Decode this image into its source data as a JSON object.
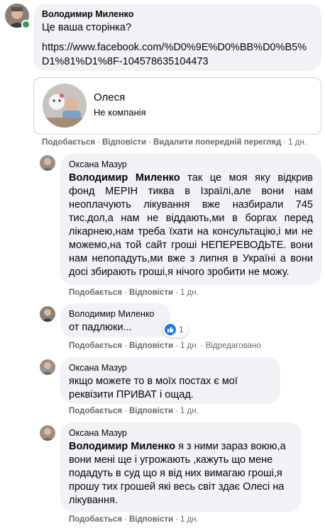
{
  "comment1": {
    "author": "Володимир Миленко",
    "text": "Це ваша сторінка?",
    "link": "https://www.facebook.com/%D0%9E%D0%BB%D0%B5%D1%81%D1%8F-104578635104473",
    "actions": {
      "like": "Подобається",
      "reply": "Відповісти",
      "remove": "Видалити попередній перегляд",
      "time": "1 дн."
    }
  },
  "link_preview": {
    "name": "Олеся",
    "subtitle": "Не компанія"
  },
  "comment2": {
    "author": "Оксана Мазур",
    "mention": "Володимир Миленко",
    "text": " так це моя яку відкрив фонд МЕРІН тиква в Ізраїлі,але вони нам неоплачують лікування вже назбирали 745 тис.дол,а нам не віддають,ми в боргах перед лікарнею,нам треба їхати на консультацію,і ми не можемо,на той сайт гроші НЕПЕРЕВОДЬТЕ. вони нам непопадуть,ми вже з липня в Україні а вони досі збирають гроші,я нічого зробити не можу.",
    "actions": {
      "like": "Подобається",
      "reply": "Відповісти",
      "time": "1 дн."
    }
  },
  "comment3": {
    "author": "Володимир Миленко",
    "text": "от падлюки...",
    "reaction_count": "1",
    "actions": {
      "like": "Подобається",
      "reply": "Відповісти",
      "time": "1 дн.",
      "edited": "Відредаговано"
    }
  },
  "comment4": {
    "author": "Оксана Мазур",
    "text": "якщо можете то в моїх постах є мої реквізити ПРИВАТ і ощад.",
    "actions": {
      "like": "Подобається",
      "reply": "Відповісти",
      "time": "1 дн."
    }
  },
  "comment5": {
    "author": "Оксана Мазур",
    "mention": "Володимир Миленко",
    "text": " я з ними зараз воюю,а вони мені ще і угрожають ,кажуть що мене подадуть в суд що я від них вимагаю гроші,я прошу тих грошей які весь світ здає Олесі на лікування.",
    "actions": {
      "like": "Подобається",
      "reply": "Відповісти",
      "time": "1 дн."
    }
  },
  "colors": {
    "bubble": "#f0f2f5",
    "meta": "#65676b",
    "like_blue": "#1877f2",
    "online": "#31a24c"
  }
}
